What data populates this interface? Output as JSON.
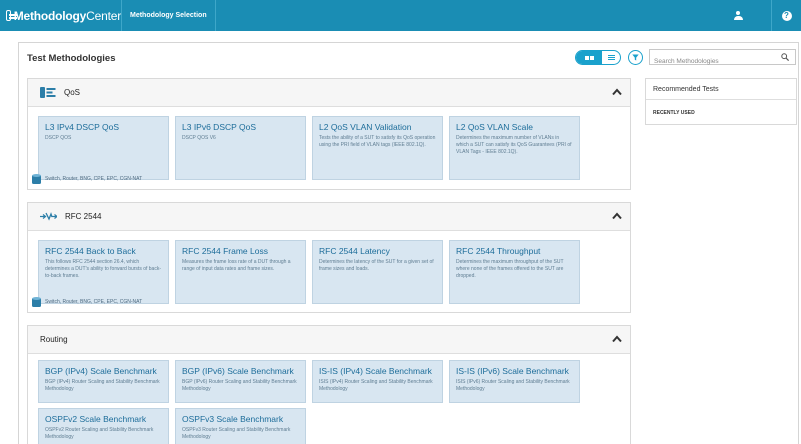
{
  "app": {
    "logo_bold": "Methodology",
    "logo_light": "Center",
    "nav_tab": "Methodology Selection",
    "help_glyph": "?"
  },
  "header": {
    "title": "Test Methodologies",
    "search_placeholder": "Search Methodologies"
  },
  "categories": [
    {
      "title": "QoS",
      "icon": "qos-icon",
      "footer": "Switch, Router, BNG, CPE, EPC, CGN-NAT",
      "cards": [
        {
          "title": "L3 IPv4 DSCP QoS",
          "desc": "DSCP QOS"
        },
        {
          "title": "L3 IPv6 DSCP QoS",
          "desc": "DSCP QOS V6"
        },
        {
          "title": "L2 QoS VLAN Validation",
          "desc": "Tests the ability of a SUT to satisfy its QoS operation using the PRI field of VLAN tags (IEEE 802.1Q)."
        },
        {
          "title": "L2 QoS VLAN Scale",
          "desc": "Determines the maximum number of VLANs in which a SUT can satisfy its QoS Guarantees (PRI of VLAN Tags - IEEE 802.1Q)."
        }
      ]
    },
    {
      "title": "RFC 2544",
      "icon": "rfc-icon",
      "footer": "Switch, Router, BNG, CPE, EPC, CGN-NAT",
      "cards": [
        {
          "title": "RFC 2544 Back to Back",
          "desc": "This follows RFC 2544 section 26.4, which determines a DUT's ability to forward bursts of back-to-back frames."
        },
        {
          "title": "RFC 2544 Frame Loss",
          "desc": "Measures the frame loss rate of a DUT through a range of input data rates and frame sizes."
        },
        {
          "title": "RFC 2544 Latency",
          "desc": "Determines the latency of the SUT for a given set of frame sizes and loads."
        },
        {
          "title": "RFC 2544 Throughput",
          "desc": "Determines the maximum throughput of the SUT where none of the frames offered to the SUT are dropped."
        }
      ]
    },
    {
      "title": "Routing",
      "cards": [
        {
          "title": "BGP (IPv4) Scale Benchmark",
          "desc": "BGP (IPv4) Router Scaling and Stability Benchmark Methodology"
        },
        {
          "title": "BGP (IPv6) Scale Benchmark",
          "desc": "BGP (IPv6) Router Scaling and Stability Benchmark Methodology"
        },
        {
          "title": "IS-IS (IPv4) Scale Benchmark",
          "desc": "ISIS (IPv4) Router Scaling and Stability Benchmark Methodology"
        },
        {
          "title": "IS-IS (IPv6) Scale Benchmark",
          "desc": "ISIS (IPv6) Router Scaling and Stability Benchmark Methodology"
        },
        {
          "title": "OSPFv2 Scale Benchmark",
          "desc": "OSPFv2 Router Scaling and Stability Benchmark Methodology"
        },
        {
          "title": "OSPFv3 Scale Benchmark",
          "desc": "OSPFv3 Router Scaling and Stability Benchmark Methodology"
        }
      ]
    }
  ],
  "sidebar": {
    "title": "Recommended Tests",
    "recent": "RECENTLY USED"
  },
  "colors": {
    "topbar": "#1a8db4",
    "accent": "#1aa1cc",
    "card_bg": "#d8e6f1",
    "card_title": "#1d6d9a"
  }
}
